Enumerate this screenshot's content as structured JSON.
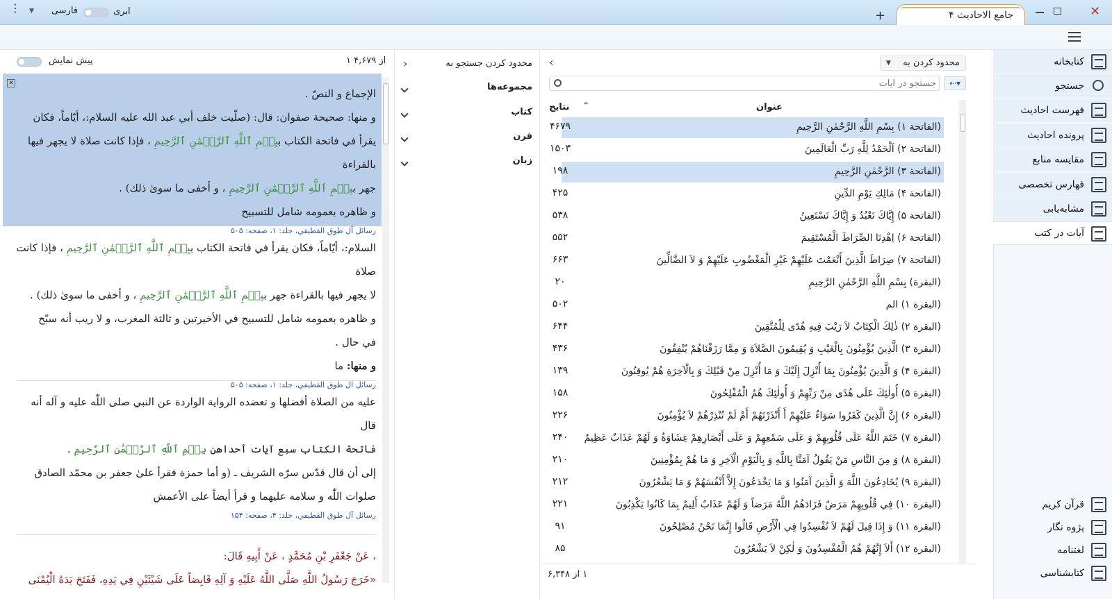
{
  "window": {
    "tab_title": "جامع الاحادیث ۴",
    "language": "فارسی",
    "cloud": "ابری"
  },
  "sidebar": {
    "items": [
      {
        "label": "کتابخانه",
        "icon": "library-icon"
      },
      {
        "label": "جستجو",
        "icon": "search-icon"
      },
      {
        "label": "فهرست احادیث",
        "icon": "list-icon"
      },
      {
        "label": "پرونده احادیث",
        "icon": "file-icon"
      },
      {
        "label": "مقایسه منابع",
        "icon": "compare-icon"
      },
      {
        "label": "فهارس تخصصی",
        "icon": "index-icon"
      },
      {
        "label": "مشابه‌یابی",
        "icon": "similar-icon"
      },
      {
        "label": "آیات در کتب",
        "icon": "verses-icon"
      }
    ],
    "bottom": [
      {
        "label": "قرآن کریم",
        "icon": "quran-icon"
      },
      {
        "label": "پژوه نگار",
        "icon": "notebook-icon"
      },
      {
        "label": "لغتنامه",
        "icon": "dictionary-icon"
      },
      {
        "label": "کتابشناسی",
        "icon": "info-icon"
      }
    ]
  },
  "results": {
    "restrict_label": "محدود کردن به",
    "search_placeholder": "جستجو در آیات",
    "col_title": "عنوان",
    "col_count": "نتایج",
    "footer": "۱ از ۶,۳۴۸",
    "rows": [
      {
        "title": "(الفاتحة ۱) بِسْمِ اللَّهِ الرَّحْمٰنِ الرَّحِيمِ",
        "count": "۴۶۷۹"
      },
      {
        "title": "(الفاتحة ۲) اَلْحَمْدُ لِلَّهِ رَبِّ الْعَالَمِينَ",
        "count": "۱۵۰۳"
      },
      {
        "title": "(الفاتحة ۳) الرَّحْمٰنِ الرَّحِيمِ",
        "count": "۱۹۸"
      },
      {
        "title": "(الفاتحة ۴) مَالِكِ يَوْمِ الدِّينِ",
        "count": "۴۲۵"
      },
      {
        "title": "(الفاتحة ۵) إِيَّاكَ نَعْبُدُ وَ إِيَّاكَ نَسْتَعِينُ",
        "count": "۵۳۸"
      },
      {
        "title": "(الفاتحة ۶) اِهْدِنَا الصِّرَاطَ الْمُسْتَقِيمَ",
        "count": "۵۵۲"
      },
      {
        "title": "(الفاتحة ۷) صِرَاطَ الَّذِينَ أَنْعَمْتَ عَلَيْهِمْ غَيْرِ الْمَغْضُوبِ عَلَيْهِمْ وَ لاَ الضَّالِّينَ",
        "count": "۶۶۳"
      },
      {
        "title": "(البقرة) بِسْمِ اللَّهِ الرَّحْمٰنِ الرَّحِيمِ",
        "count": "۲۰"
      },
      {
        "title": "(البقرة ۱) الم",
        "count": "۵۰۲"
      },
      {
        "title": "(البقرة ۲) ذٰلِكَ الْكِتَابُ لاَ رَيْبَ فِيهِ هُدًى لِلْمُتَّقِينَ",
        "count": "۶۴۴"
      },
      {
        "title": "(البقرة ۳) الَّذِينَ يُؤْمِنُونَ بِالْغَيْبِ وَ يُقِيمُونَ الصَّلاَةَ وَ مِمَّا رَزَقْنَاهُمْ يُنْفِقُونَ",
        "count": "۴۳۶"
      },
      {
        "title": "(البقرة ۴) وَ الَّذِينَ يُؤْمِنُونَ بِمَا أُنْزِلَ إِلَيْكَ وَ مَا أُنْزِلَ مِنْ قَبْلِكَ وَ بِالْآخِرَةِ هُمْ يُوقِنُونَ",
        "count": "۱۳۹"
      },
      {
        "title": "(البقرة ۵) أُولٰئِكَ عَلَى هُدًى مِنْ رَبِّهِمْ وَ أُولٰئِكَ هُمُ الْمُفْلِحُونَ",
        "count": "۱۵۸"
      },
      {
        "title": "(البقرة ۶) إِنَّ الَّذِينَ كَفَرُوا سَوَاءٌ عَلَيْهِمْ أَ أَنْذَرْتَهُمْ أَمْ لَمْ تُنْذِرْهُمْ لاَ يُؤْمِنُونَ",
        "count": "۲۲۶"
      },
      {
        "title": "(البقرة ۷) خَتَمَ اللَّهُ عَلَى قُلُوبِهِمْ وَ عَلَى سَمْعِهِمْ وَ عَلَى أَبْصَارِهِمْ غِشَاوَةٌ وَ لَهُمْ عَذَابٌ عَظِيمٌ",
        "count": "۲۴۰"
      },
      {
        "title": "(البقرة ۸) وَ مِنَ النَّاسِ مَنْ يَقُولُ آمَنَّا بِاللَّهِ وَ بِالْيَوْمِ الْآخِرِ وَ مَا هُمْ بِمُؤْمِنِينَ",
        "count": "۲۱۰"
      },
      {
        "title": "(البقرة ۹) يُخَادِعُونَ اللَّهَ وَ الَّذِينَ آمَنُوا وَ مَا يَخْدَعُونَ إِلاَّ أَنْفُسَهُمْ وَ مَا يَشْعُرُونَ",
        "count": "۲۱۲"
      },
      {
        "title": "(البقرة ۱۰) فِي قُلُوبِهِمْ مَرَضٌ فَزَادَهُمُ اللَّهُ مَرَضاً وَ لَهُمْ عَذَابٌ أَلِيمٌ بِمَا كَانُوا يَكْذِبُونَ",
        "count": "۲۲۱"
      },
      {
        "title": "(البقرة ۱۱) وَ إِذَا قِيلَ لَهُمْ لاَ تُفْسِدُوا فِي الْأَرْضِ قَالُوا إِنَّمَا نَحْنُ مُصْلِحُونَ",
        "count": "۹۱"
      },
      {
        "title": "(البقرة ۱۲) أَلاَ إِنَّهُمْ هُمُ الْمُفْسِدُونَ وَ لٰكِنْ لاَ يَشْعُرُونَ",
        "count": "۸۵"
      }
    ]
  },
  "filter": {
    "title": "محدود کردن جستجو به",
    "items": [
      "مجموعه‌ها",
      "کتاب",
      "قرن",
      "زبان"
    ]
  },
  "reader": {
    "counter": "۱ از ۴,۶۷۹",
    "preview": "پیش نمایش",
    "b1": {
      "l1": "الإجماع و النصّ .",
      "l2": "و منها: صحيحة صفوان: قال: (صلّيت خلف أبي عبد الله عليه السلام:، أيّاماً، فكان",
      "l3a": "يقرأ في فاتحة الكتاب ب",
      "l3g": "بِسۡمِ ٱللَّهِ ٱلرَّحۡمَٰنِ ٱلرَّحِيمِ",
      "l3b": "، فإذا كانت صلاة لا يجهر فيها بالقراءة",
      "l4a": "جهر ب",
      "l4g": "بِسۡمِ ٱللَّهِ ٱلرَّحۡمَٰنِ ٱلرَّحِيمِ",
      "l4b": "، و أخفى ما سوىٰ ذلك) .",
      "l5": "و ظاهره بعمومه شامل للتسبيح",
      "src": "رسائل آل طوق القطيفي، جلد: ۱، صفحه: ۵۰۵"
    },
    "b2": {
      "l1a": "السلام:، أيّاماً، فكان يقرأ في فاتحة الكتاب ب",
      "l1g": "بِسۡمِ ٱللَّهِ ٱلرَّحۡمَٰنِ ٱلرَّحِيمِ",
      "l1b": "، فإذا كانت صلاة",
      "l2a": "لا يجهر فيها بالقراءة جهر ب",
      "l2g": "بِسۡمِ ٱللَّهِ ٱلرَّحۡمَٰنِ ٱلرَّحِيمِ",
      "l2b": "، و أخفى ما سوىٰ ذلك) .",
      "l3": "و ظاهره بعمومه شامل للتسبيح في الأخيرتين و ثالثة المغرب، و لا ريب أنه سبّح",
      "l4": "في حال .",
      "l5a": "و منها:",
      "l5b": "ما",
      "src": "رسائل آل طوق القطيفي، جلد: ۱، صفحه: ۵۰۵"
    },
    "b3": {
      "l1": "عليه من الصلاة أفضلها و تعضده الرواية الواردة عن النبي صلى اللّٰه عليه و آله أنه",
      "l2": "قال",
      "l3a": "فاتحة الكتاب سبع آيات أحداهن",
      "l3g": "بِسۡمِ ٱللَّهِ ٱلرَّحۡمَٰنِ ٱلرَّحِيمِ",
      "l3b": ".",
      "l4": "إلى أن قال قدّس سرّه الشريف ـ (و أما حمزة فقرأ علىٰ جعفر بن محمّد الصادق",
      "l5": "صلوات اللّٰه و سلامه عليهما و قرأ أيضاً على الأعمش",
      "src": "رسائل آل طوق القطيفي، جلد: ۴، صفحه: ۱۵۴"
    },
    "b4": {
      "l1": "، عَنْ جَعْفَرِ بْنِ مُحَمَّدٍ ، عَنْ أَبِيهِ قَالَ:",
      "l2": "«خَرَجَ رَسُولُ اللَّهِ صَلَّى اللَّهُ عَلَيْهِ وَ آلِهِ قَابِضاً عَلَى شَيْئَيْنِ فِي يَدِهِ، فَفَتَحَ يَدَهُ الْيُمْنَى"
    }
  }
}
